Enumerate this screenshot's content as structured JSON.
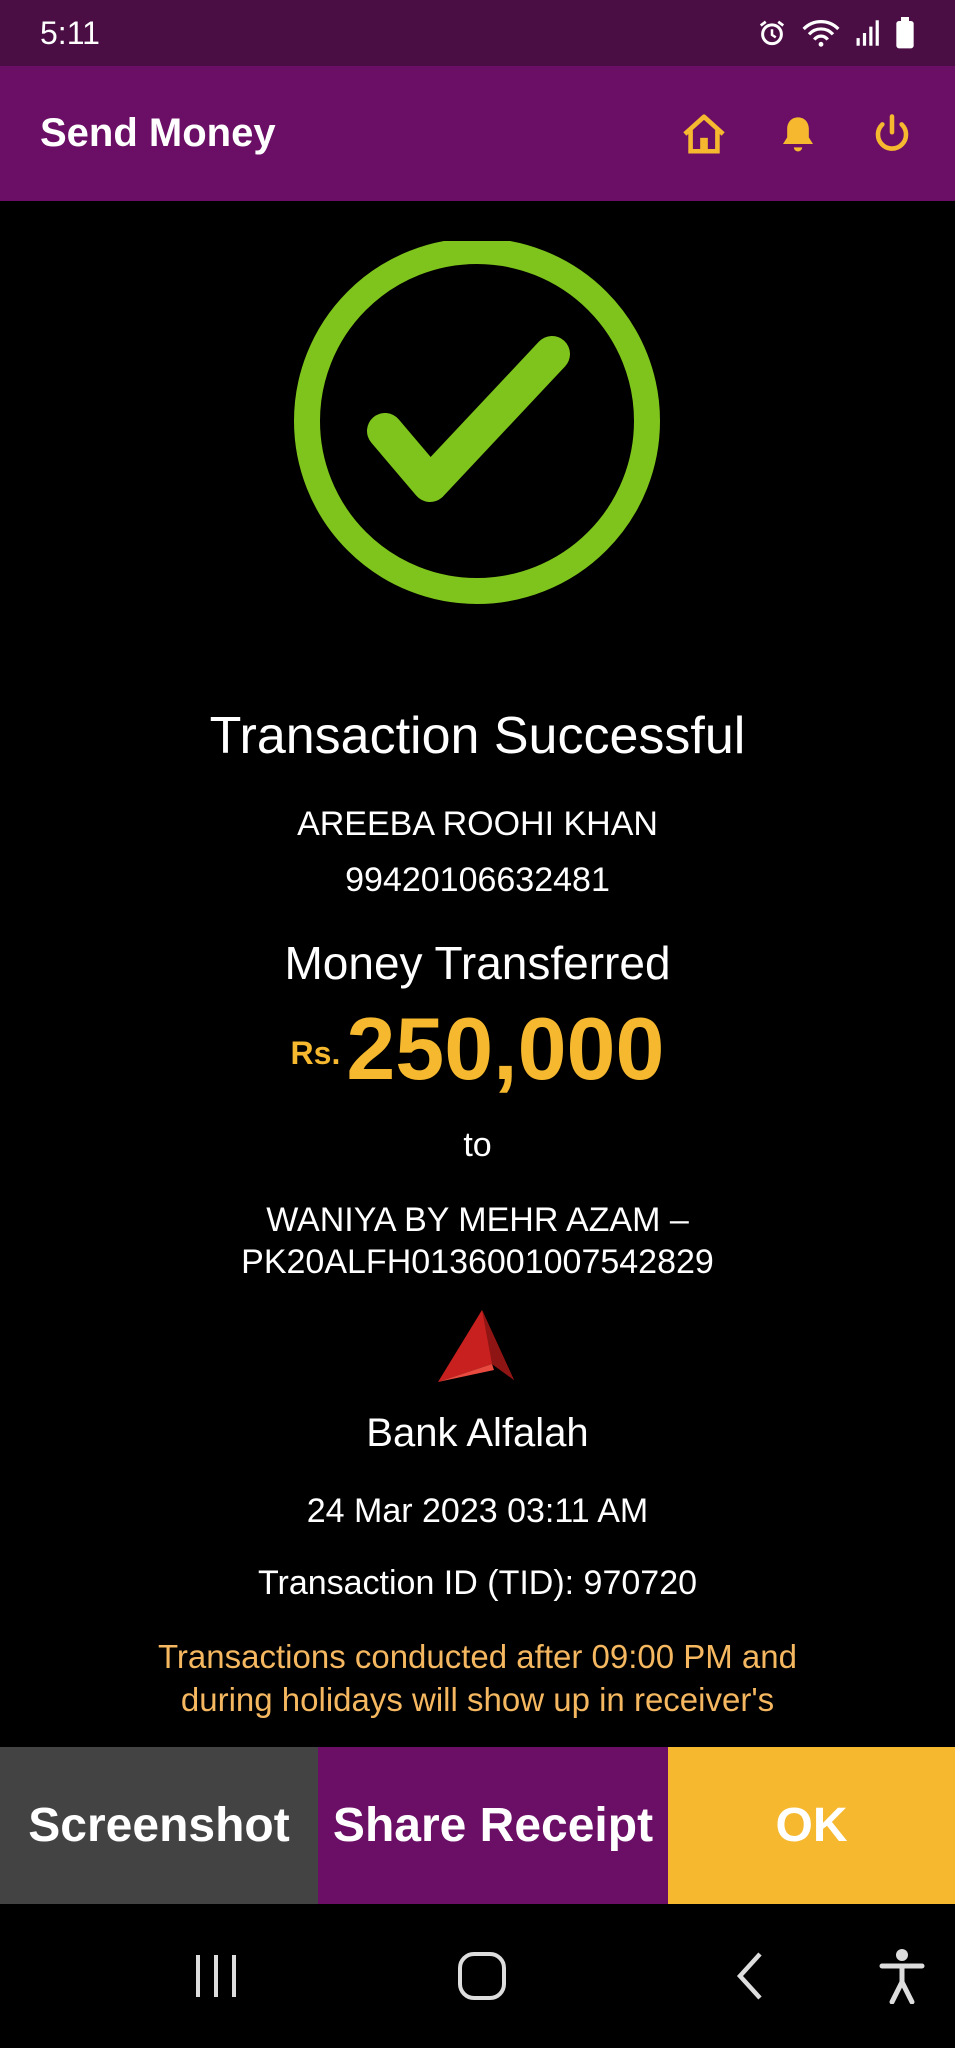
{
  "status_bar": {
    "time": "5:11",
    "icons": [
      "alarm-icon",
      "wifi-icon",
      "signal-icon",
      "battery-icon"
    ]
  },
  "app_bar": {
    "title": "Send Money",
    "actions": [
      "home-icon",
      "bell-icon",
      "power-icon"
    ],
    "icon_color": "#f5b82e",
    "background": "#6b0f66"
  },
  "receipt": {
    "status_icon": "check-circle-icon",
    "status_color": "#7ec41c",
    "title": "Transaction Successful",
    "sender_name": "AREEBA ROOHI KHAN",
    "sender_account": "99420106632481",
    "money_label": "Money Transferred",
    "currency": "Rs.",
    "amount": "250,000",
    "to_label": "to",
    "recipient_line1": "WANIYA BY MEHR AZAM –",
    "recipient_line2": "PK20ALFH0136001007542829",
    "bank_logo": "bank-alfalah-logo",
    "bank_name": "Bank Alfalah",
    "datetime": "24 Mar 2023 03:11 AM",
    "transaction_id": "Transaction ID (TID): 970720",
    "notice": "Transactions conducted after 09:00 PM and during holidays will show up in receiver's"
  },
  "actions": {
    "screenshot": "Screenshot",
    "share": "Share Receipt",
    "ok": "OK"
  },
  "nav_bar": {
    "buttons": [
      "recents-icon",
      "home-nav-icon",
      "back-icon",
      "accessibility-icon"
    ]
  }
}
